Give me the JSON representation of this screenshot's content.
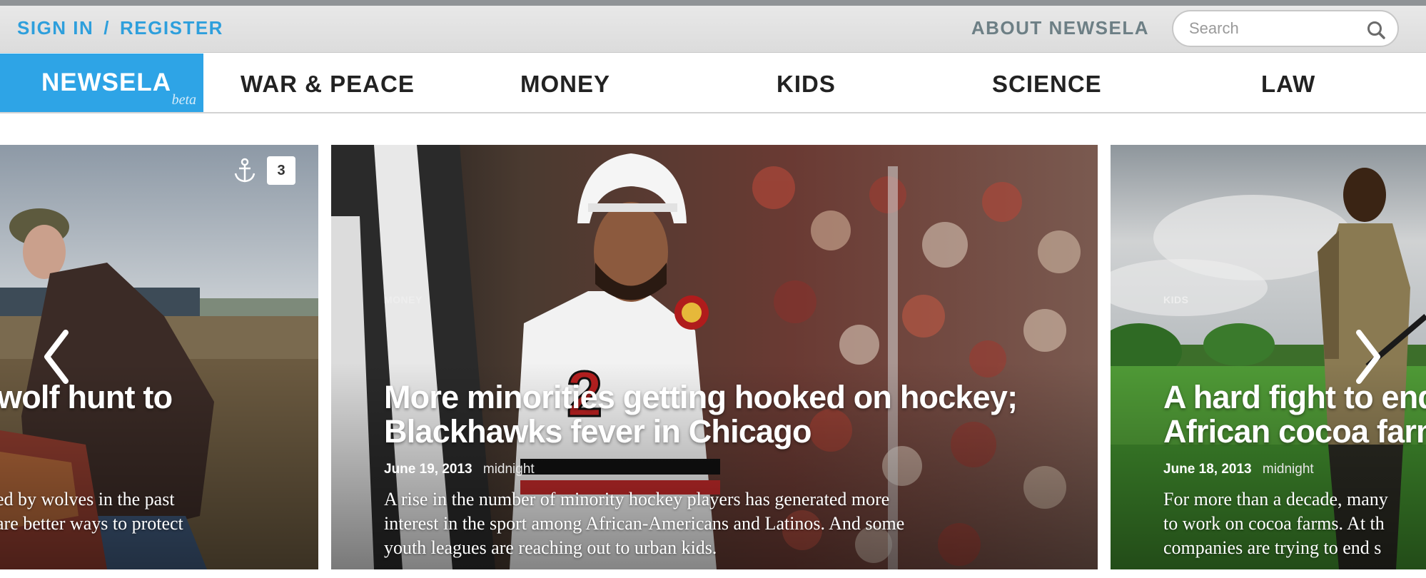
{
  "header": {
    "sign_in": "SIGN IN",
    "separator": "/",
    "register": "REGISTER",
    "about": "ABOUT NEWSELA",
    "search_placeholder": "Search"
  },
  "nav": {
    "brand": "NEWSELA",
    "brand_badge": "beta",
    "items": [
      "WAR & PEACE",
      "MONEY",
      "KIDS",
      "SCIENCE",
      "LAW"
    ]
  },
  "carousel": {
    "left_card": {
      "headline": "wolf hunt to",
      "summary_line1": "ed by wolves in the past",
      "summary_line2": "are better ways to protect",
      "bookmark_count": "3"
    },
    "center_card": {
      "category": "MONEY",
      "headline_line1": "More minorities getting hooked on hockey;",
      "headline_line2": "Blackhawks fever in Chicago",
      "date": "June 19, 2013",
      "author": "midnight",
      "summary_line1": "A rise in the number of minority hockey players has generated more",
      "summary_line2": "interest in the sport among African-Americans and Latinos. And some",
      "summary_line3": "youth leagues are reaching out to urban kids."
    },
    "right_card": {
      "category": "KIDS",
      "headline_line1": "A hard fight to end",
      "headline_line2": "African cocoa farm",
      "date": "June 18, 2013",
      "author": "midnight",
      "summary_line1": "For more than a decade, many",
      "summary_line2": "to work on cocoa farms. At th",
      "summary_line3": "companies are trying to end s"
    }
  },
  "colors": {
    "brand_blue": "#2ea4e6",
    "link_blue": "#2e9fdc",
    "about_gray": "#6d7f85"
  }
}
